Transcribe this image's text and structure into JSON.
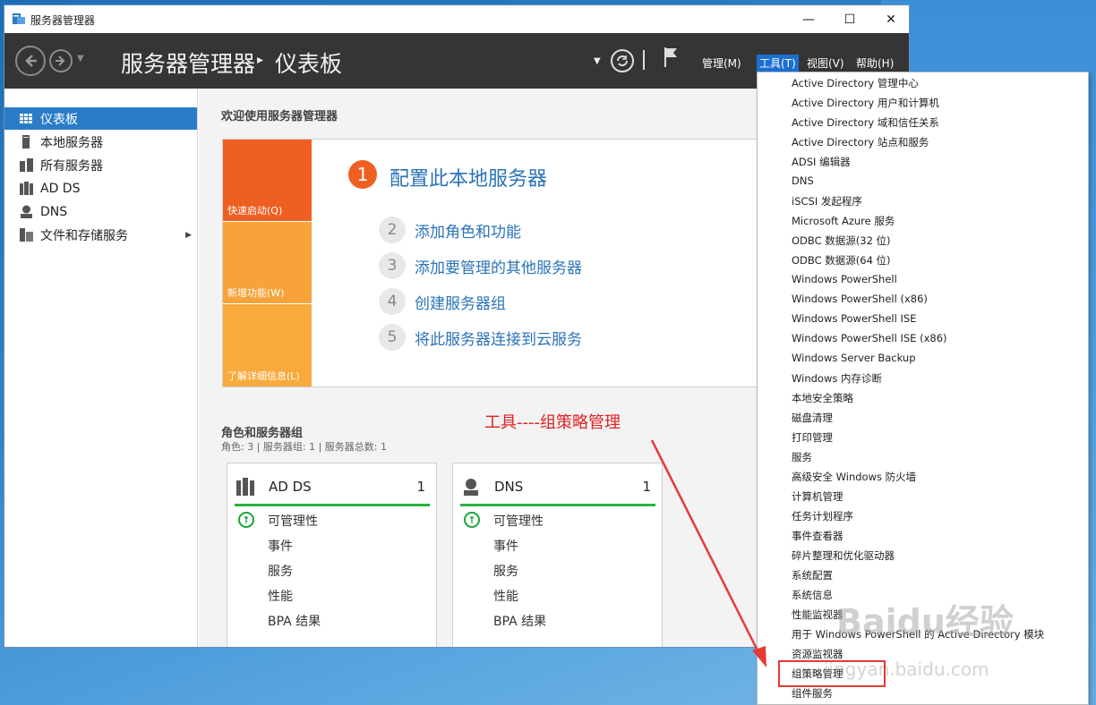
{
  "window": {
    "title": "服务器管理器",
    "min_glyph": "—",
    "max_glyph": "☐",
    "close_glyph": "✕"
  },
  "header": {
    "breadcrumb_root": "服务器管理器",
    "breadcrumb_sep": "▸",
    "breadcrumb_current": "仪表板",
    "menus": [
      "管理(M)",
      "工具(T)",
      "视图(V)",
      "帮助(H)"
    ],
    "active_menu": "工具(T)",
    "accent": "#1b6fd1"
  },
  "sidebar": {
    "items": [
      {
        "label": "仪表板",
        "icon": "dashboard-icon",
        "active": true
      },
      {
        "label": "本地服务器",
        "icon": "server-icon"
      },
      {
        "label": "所有服务器",
        "icon": "servers-icon"
      },
      {
        "label": "AD DS",
        "icon": "adds-icon"
      },
      {
        "label": "DNS",
        "icon": "dns-icon"
      },
      {
        "label": "文件和存储服务",
        "icon": "file-storage-icon",
        "has_submenu": true
      }
    ]
  },
  "main": {
    "welcome": "欢迎使用服务器管理器",
    "tiles": [
      "快速启动(Q)",
      "新增功能(W)",
      "了解详细信息(L)"
    ],
    "step1": {
      "num": "1",
      "label": "配置此本地服务器"
    },
    "steps": [
      {
        "num": "2",
        "label": "添加角色和功能"
      },
      {
        "num": "3",
        "label": "添加要管理的其他服务器"
      },
      {
        "num": "4",
        "label": "创建服务器组"
      },
      {
        "num": "5",
        "label": "将此服务器连接到云服务"
      }
    ],
    "roles_title": "角色和服务器组",
    "roles_subtitle": "角色: 3 | 服务器组: 1 | 服务器总数: 1",
    "cards": [
      {
        "name": "AD DS",
        "count": "1",
        "rows": [
          "可管理性",
          "事件",
          "服务",
          "性能",
          "BPA 结果"
        ]
      },
      {
        "name": "DNS",
        "count": "1",
        "rows": [
          "可管理性",
          "事件",
          "服务",
          "性能",
          "BPA 结果"
        ]
      }
    ]
  },
  "annotation": "工具----组策略管理",
  "tools_menu": {
    "items": [
      "Active Directory 管理中心",
      "Active Directory 用户和计算机",
      "Active Directory 域和信任关系",
      "Active Directory 站点和服务",
      "ADSI 编辑器",
      "DNS",
      "iSCSI 发起程序",
      "Microsoft Azure 服务",
      "ODBC 数据源(32 位)",
      "ODBC 数据源(64 位)",
      "Windows PowerShell",
      "Windows PowerShell (x86)",
      "Windows PowerShell ISE",
      "Windows PowerShell ISE (x86)",
      "Windows Server Backup",
      "Windows 内存诊断",
      "本地安全策略",
      "磁盘清理",
      "打印管理",
      "服务",
      "高级安全 Windows 防火墙",
      "计算机管理",
      "任务计划程序",
      "事件查看器",
      "碎片整理和优化驱动器",
      "系统配置",
      "系统信息",
      "性能监视器",
      "用于 Windows PowerShell 的 Active Directory 模块",
      "资源监视器",
      "组策略管理",
      "组件服务"
    ],
    "highlighted": "组策略管理"
  },
  "watermark": {
    "brand": "Baidu经验",
    "url": "jingyan.baidu.com"
  }
}
